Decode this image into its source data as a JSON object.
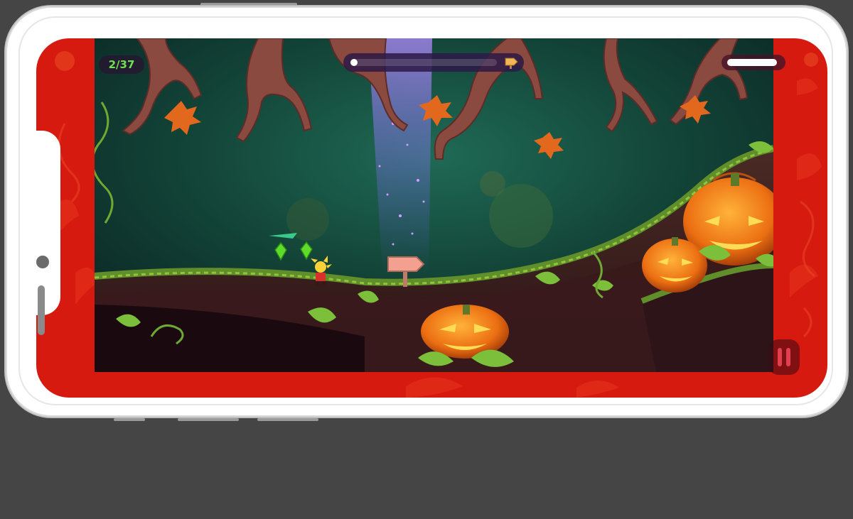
{
  "game": {
    "title": "",
    "gems_counter": "2/37",
    "level_progress": 0.05,
    "energy_level": 0.95,
    "signpost_direction": "right",
    "colors": {
      "frame_border": "#d61a10",
      "hud_text": "#6fe04e",
      "pumpkin": "#f07a18",
      "forest_bg": "#123f3c"
    },
    "icons": [
      "gem-icon",
      "arrow-sign-icon",
      "pause-icon"
    ]
  }
}
